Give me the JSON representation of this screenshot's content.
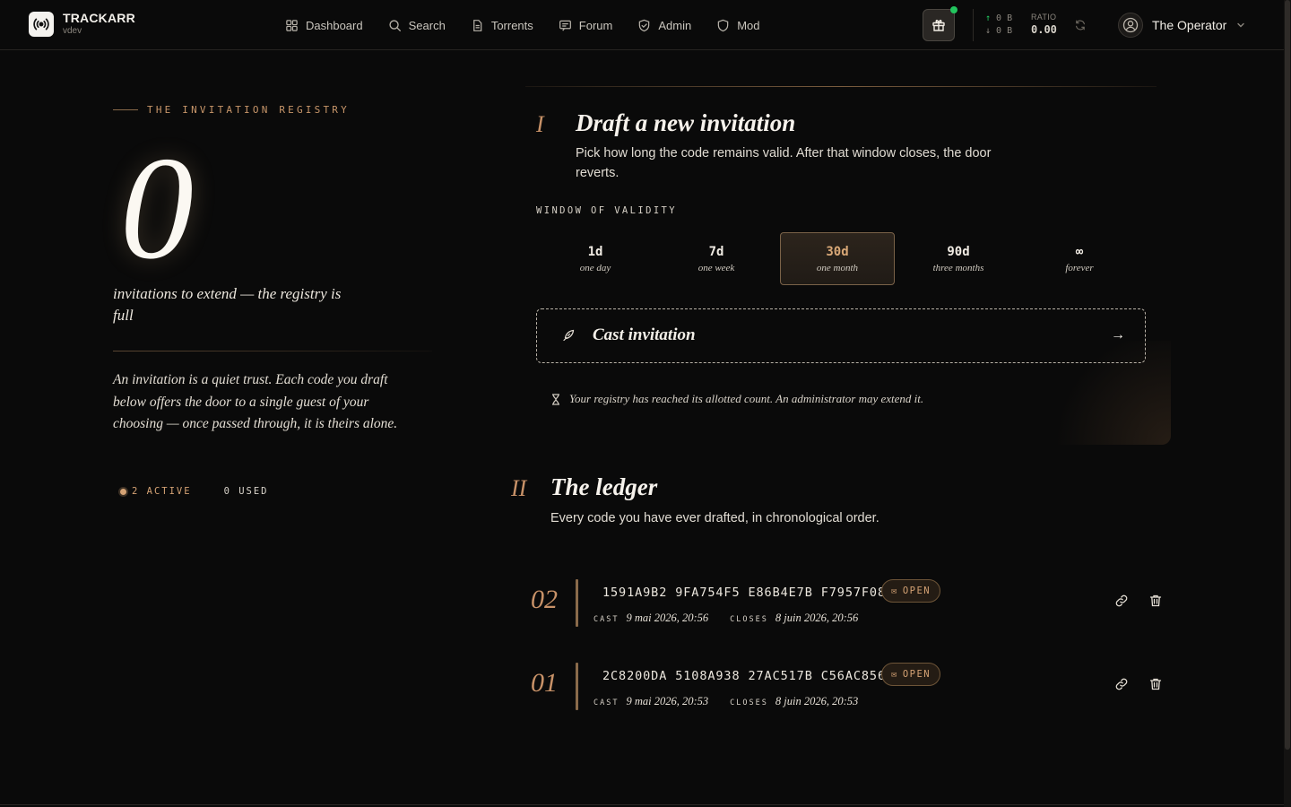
{
  "header": {
    "brand": {
      "name": "TRACKARR",
      "version": "vdev"
    },
    "nav": [
      {
        "label": "Dashboard",
        "icon": "grid-icon"
      },
      {
        "label": "Search",
        "icon": "search-icon"
      },
      {
        "label": "Torrents",
        "icon": "file-icon"
      },
      {
        "label": "Forum",
        "icon": "message-icon"
      },
      {
        "label": "Admin",
        "icon": "shield-check-icon"
      },
      {
        "label": "Mod",
        "icon": "shield-icon"
      }
    ],
    "traffic": {
      "upload": "0 B",
      "download": "0 B"
    },
    "ratio": {
      "label": "RATIO",
      "value": "0.00"
    },
    "user": {
      "name": "The Operator"
    },
    "colors": {
      "online_dot": "#22c55e",
      "accent": "#d4a274"
    }
  },
  "registry": {
    "eyebrow": "THE INVITATION REGISTRY",
    "count": "0",
    "caption": "invitations to extend — the registry is full",
    "blurb": "An invitation is a quiet trust. Each code you draft below offers the door to a single guest of your choosing — once passed through, it is theirs alone.",
    "active": "2 ACTIVE",
    "used": "0 USED"
  },
  "draft": {
    "numeral": "I",
    "title": "Draft a new invitation",
    "description": "Pick how long the code remains valid. After that window closes, the door reverts.",
    "validity_label": "WINDOW OF VALIDITY",
    "options": [
      {
        "value": "1d",
        "label": "one day",
        "selected": false
      },
      {
        "value": "7d",
        "label": "one week",
        "selected": false
      },
      {
        "value": "30d",
        "label": "one month",
        "selected": true
      },
      {
        "value": "90d",
        "label": "three months",
        "selected": false
      },
      {
        "value": "∞",
        "label": "forever",
        "selected": false
      }
    ],
    "cast_label": "Cast invitation",
    "cast_arrow": "→",
    "note": "Your registry has reached its allotted count. An administrator may extend it."
  },
  "ledger": {
    "numeral": "II",
    "title": "The ledger",
    "description": "Every code you have ever drafted, in chronological order.",
    "cast_label": "CAST",
    "closes_label": "CLOSES",
    "rows": [
      {
        "index": "02",
        "code": "1591A9B2 9FA754F5 E86B4E7B F7957F08",
        "status": "OPEN",
        "cast": "9 mai 2026, 20:56",
        "closes": "8 juin 2026, 20:56"
      },
      {
        "index": "01",
        "code": "2C8200DA 5108A938 27AC517B C56AC856",
        "status": "OPEN",
        "cast": "9 mai 2026, 20:53",
        "closes": "8 juin 2026, 20:53"
      }
    ]
  }
}
